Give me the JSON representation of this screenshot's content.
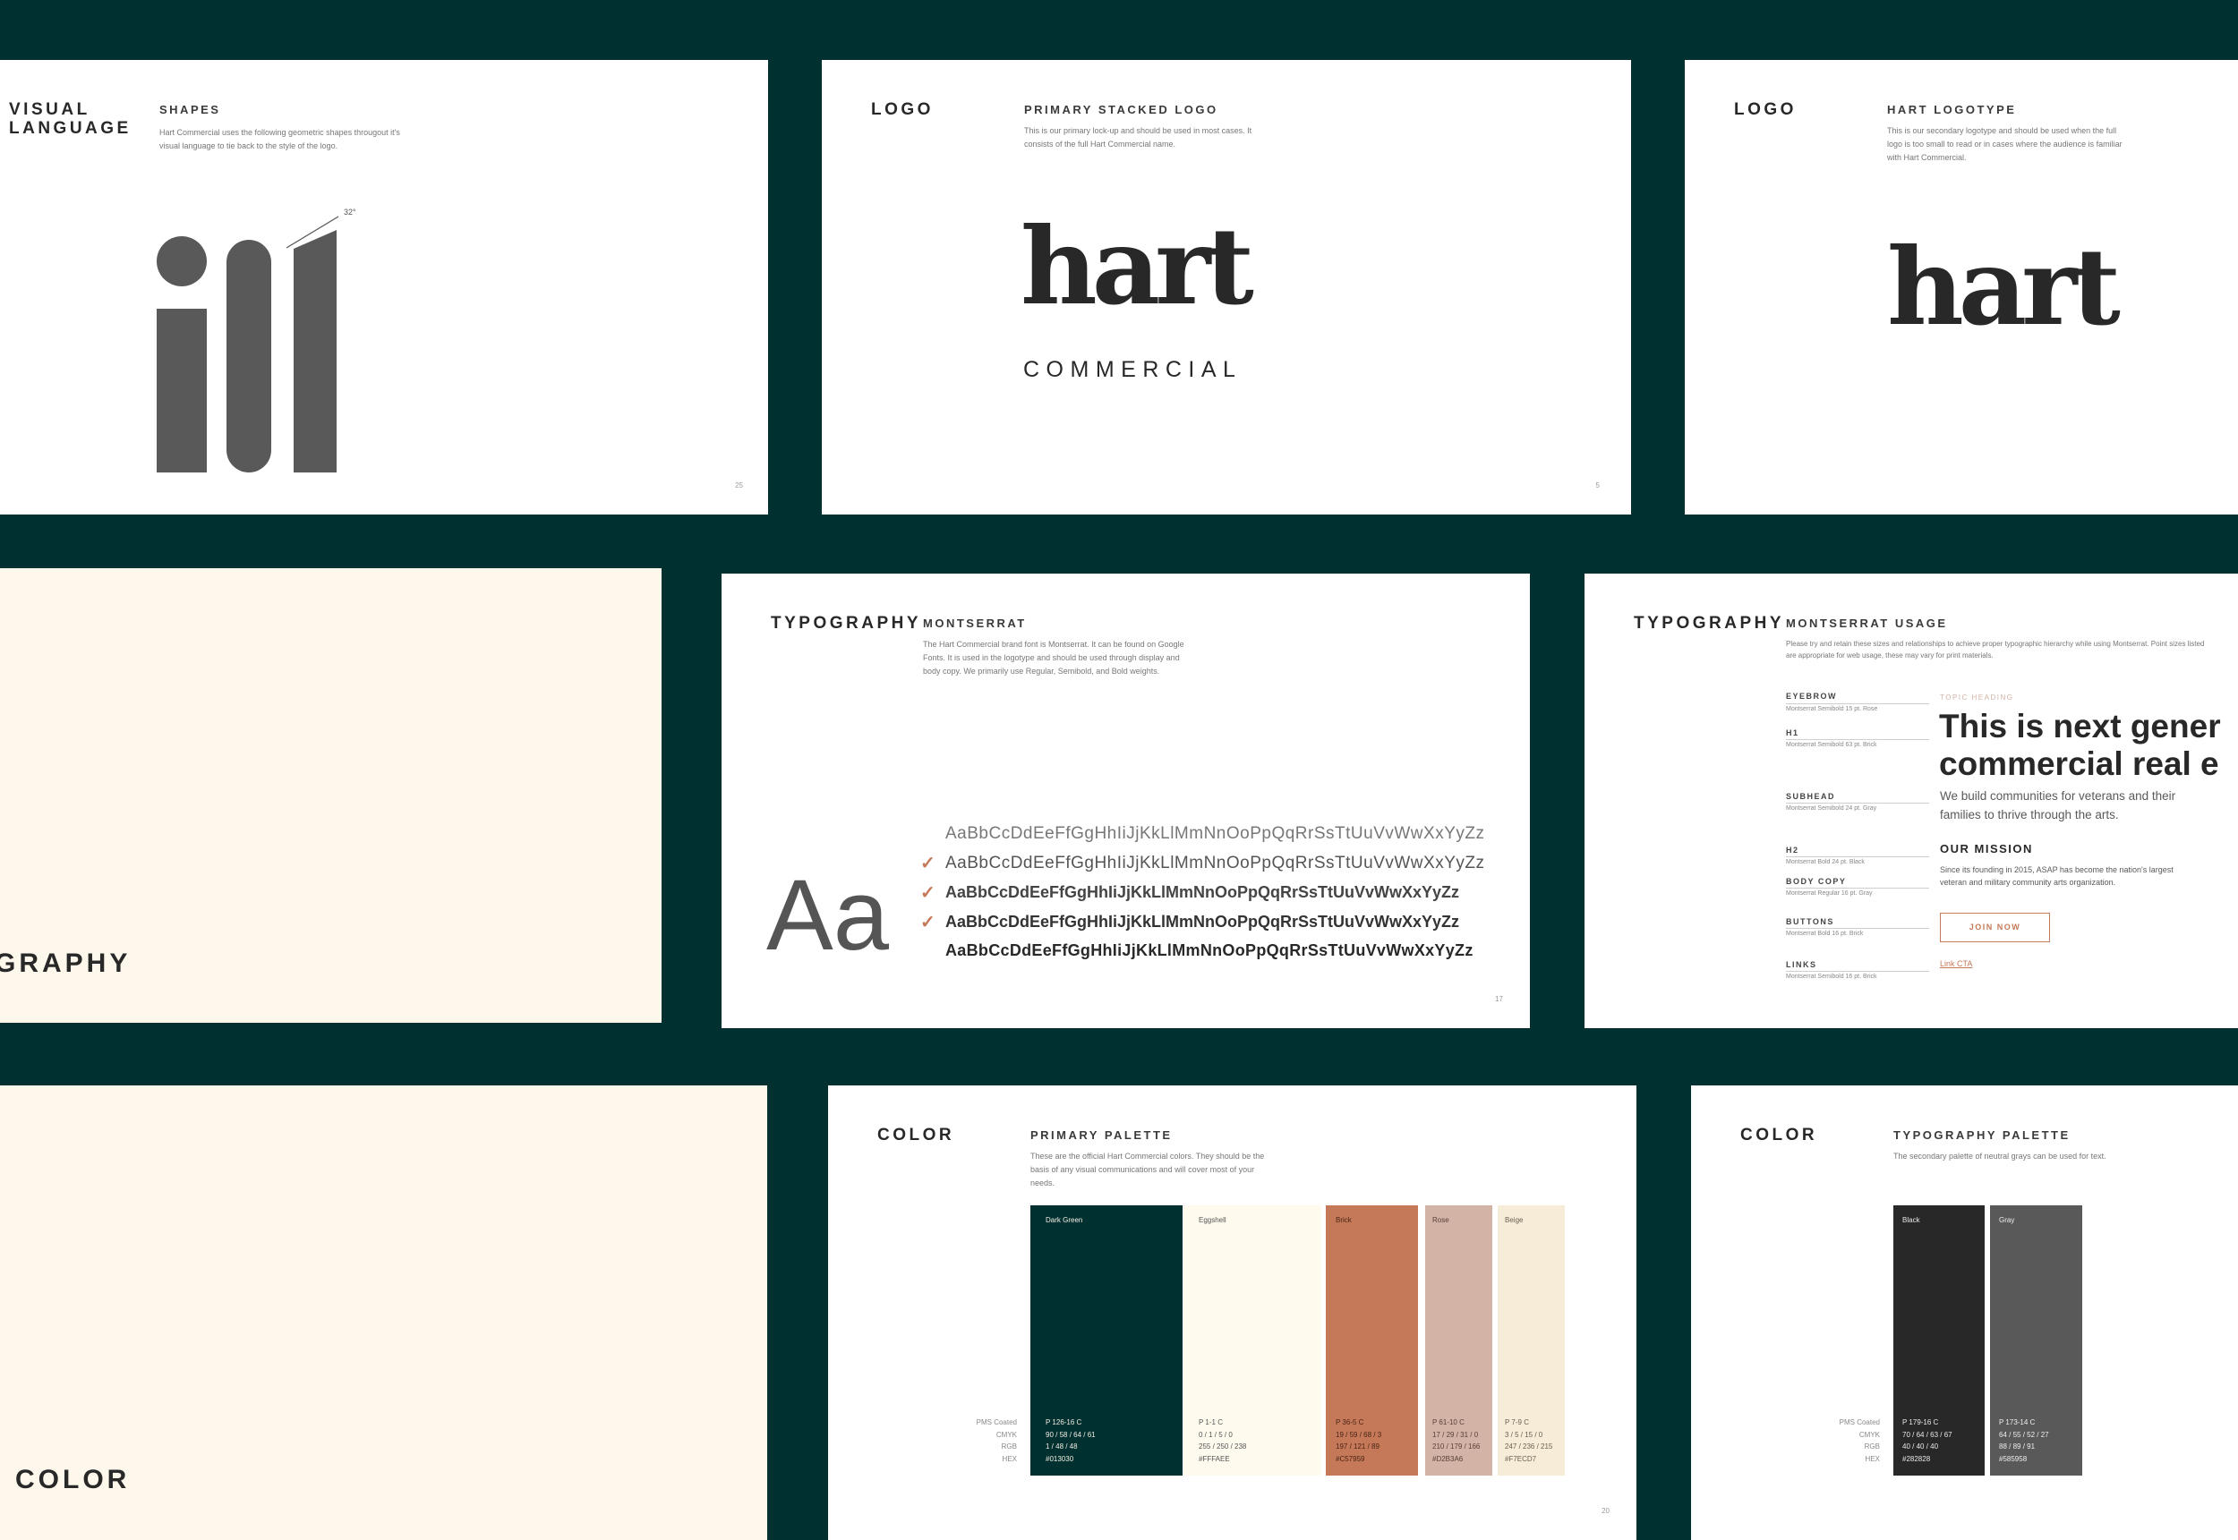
{
  "visual_language": {
    "section": "VISUAL LANGUAGE",
    "title": "SHAPES",
    "desc": "Hart Commercial uses the following geometric shapes througout it's visual language to tie back to the style of the logo.",
    "angle": "32°",
    "page": "25"
  },
  "logo_stacked": {
    "section": "LOGO",
    "title": "PRIMARY STACKED LOGO",
    "desc": "This is our primary lock-up and should be used in most cases. It consists of the full Hart Commercial name.",
    "wordmark": "hart",
    "tagline": "COMMERCIAL",
    "page": "5"
  },
  "logotype": {
    "section": "LOGO",
    "title": "HART LOGOTYPE",
    "desc": "This is our secondary logotype and should be used when the full logo is too small to read or in cases where the audience is familiar with Hart Commercial.",
    "wordmark": "hart"
  },
  "typography_cover": {
    "title": "GRAPHY"
  },
  "typography": {
    "section": "TYPOGRAPHY",
    "title": "MONTSERRAT",
    "desc": "The Hart Commercial brand font is Montserrat. It can be found on Google Fonts. It is used in the logotype and should be used through display and body copy. We primarily use Regular, Semibold, and Bold weights.",
    "sample": "Aa",
    "alphabet": "AaBbCcDdEeFfGgHhIiJjKkLlMmNnOoPpQqRrSsTtUuVvWwXxYyZz",
    "page": "17"
  },
  "usage": {
    "section": "TYPOGRAPHY",
    "title": "MONTSERRAT USAGE",
    "desc": "Please try and retain these sizes and relationships to achieve proper typographic hierarchy while using Montserrat. Point sizes listed are appropriate for web usage, these may vary for print materials.",
    "specs": [
      {
        "label": "EYEBROW",
        "note": "Montserrat Semibold   15 pt. Rose"
      },
      {
        "label": "H1",
        "note": "Montserrat Semibold   63 pt. Brick"
      },
      {
        "label": "SUBHEAD",
        "note": "Montserrat Semibold   24 pt. Gray"
      },
      {
        "label": "H2",
        "note": "Montserrat Bold   24 pt. Black"
      },
      {
        "label": "BODY COPY",
        "note": "Montserrat Regular   16 pt. Gray"
      },
      {
        "label": "BUTTONS",
        "note": "Montserrat Bold   16 pt. Brick"
      },
      {
        "label": "LINKS",
        "note": "Montserrat Semibold   16 pt. Brick"
      }
    ],
    "eyebrow": "TOPIC HEADING",
    "h1_line1": "This is next gener",
    "h1_line2": "commercial real e",
    "subhead": "We build communities for veterans and their families to thrive through the arts.",
    "h2": "OUR MISSION",
    "body": "Since its founding in 2015, ASAP has become the nation's largest veteran and military community arts organization.",
    "button": "JOIN NOW",
    "link": "Link CTA"
  },
  "color_cover": {
    "title": "COLOR"
  },
  "primary_palette": {
    "section": "COLOR",
    "title": "PRIMARY PALETTE",
    "desc": "These are the official Hart Commercial colors. They should be the basis of any visual communications and will cover most of your needs.",
    "row_labels": [
      "PMS Coated",
      "CMYK",
      "RGB",
      "HEX"
    ],
    "swatches": [
      {
        "name": "Dark Green",
        "hex": "#013030",
        "values": [
          "P 126-16 C",
          "90 / 58 / 64 / 61",
          "1 / 48 / 48",
          "#013030"
        ]
      },
      {
        "name": "Eggshell",
        "hex": "#FFFAEE",
        "values": [
          "P 1-1 C",
          "0 / 1 / 5 / 0",
          "255 / 250 / 238",
          "#FFFAEE"
        ]
      },
      {
        "name": "Brick",
        "hex": "#C57959",
        "values": [
          "P 36-5 C",
          "19 / 59 / 68 / 3",
          "197 / 121 / 89",
          "#C57959"
        ]
      },
      {
        "name": "Rose",
        "hex": "#D2B3A6",
        "values": [
          "P 61-10 C",
          "17 / 29 / 31 / 0",
          "210 / 179 / 166",
          "#D2B3A6"
        ]
      },
      {
        "name": "Beige",
        "hex": "#F7ECD7",
        "values": [
          "P 7-9 C",
          "3 / 5 / 15 / 0",
          "247 / 236 / 215",
          "#F7ECD7"
        ]
      }
    ],
    "page": "20"
  },
  "type_palette": {
    "section": "COLOR",
    "title": "TYPOGRAPHY PALETTE",
    "desc": "The secondary palette of neutral grays can be used for text.",
    "row_labels": [
      "PMS Coated",
      "CMYK",
      "RGB",
      "HEX"
    ],
    "swatches": [
      {
        "name": "Black",
        "hex": "#282828",
        "values": [
          "P 179-16 C",
          "70 / 64 / 63 / 67",
          "40 / 40 / 40",
          "#282828"
        ]
      },
      {
        "name": "Gray",
        "hex": "#585958",
        "values": [
          "P 173-14 C",
          "64 / 55 / 52 / 27",
          "88 / 89 / 91",
          "#585958"
        ]
      }
    ]
  },
  "colors": {
    "dark_green": "#013030",
    "brick": "#C57959",
    "cream": "#FDF8EB"
  }
}
